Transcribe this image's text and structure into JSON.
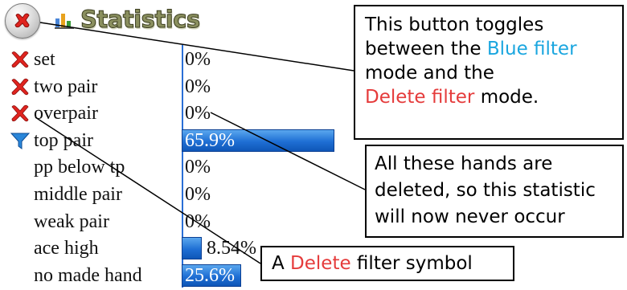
{
  "header": {
    "title": "Statistics",
    "toggle_icon": "red-x-circle-icon",
    "chart_icon": "bar-chart-icon"
  },
  "colors": {
    "bar_fill": "#1f6fd4",
    "blue_accent": "#1aa6df",
    "red_accent": "#e53b3b"
  },
  "rows": [
    {
      "label": "set",
      "icon": "red-x-icon",
      "value_pct": 0,
      "value_text": "0%"
    },
    {
      "label": "two pair",
      "icon": "red-x-icon",
      "value_pct": 0,
      "value_text": "0%"
    },
    {
      "label": "overpair",
      "icon": "red-x-icon",
      "value_pct": 0,
      "value_text": "0%"
    },
    {
      "label": "top pair",
      "icon": "blue-funnel-icon",
      "value_pct": 65.9,
      "value_text": "65.9%"
    },
    {
      "label": "pp below tp",
      "icon": "",
      "value_pct": 0,
      "value_text": "0%"
    },
    {
      "label": "middle pair",
      "icon": "",
      "value_pct": 0,
      "value_text": "0%"
    },
    {
      "label": "weak pair",
      "icon": "",
      "value_pct": 0,
      "value_text": "0%"
    },
    {
      "label": "ace high",
      "icon": "",
      "value_pct": 8.54,
      "value_text": "8.54%"
    },
    {
      "label": "no made hand",
      "icon": "",
      "value_pct": 25.6,
      "value_text": "25.6%"
    }
  ],
  "callouts": {
    "toggle": {
      "line1": "This button toggles",
      "line2_a": "between the ",
      "line2_b": "Blue filter",
      "line3": "mode and the",
      "line4_a": "Delete filter",
      "line4_b": " mode."
    },
    "deleted": {
      "line1": "All these hands are",
      "line2": "deleted, so this statistic",
      "line3": "will now never occur"
    },
    "symbol": {
      "a": "A ",
      "b": "Delete",
      "c": " filter symbol"
    }
  }
}
